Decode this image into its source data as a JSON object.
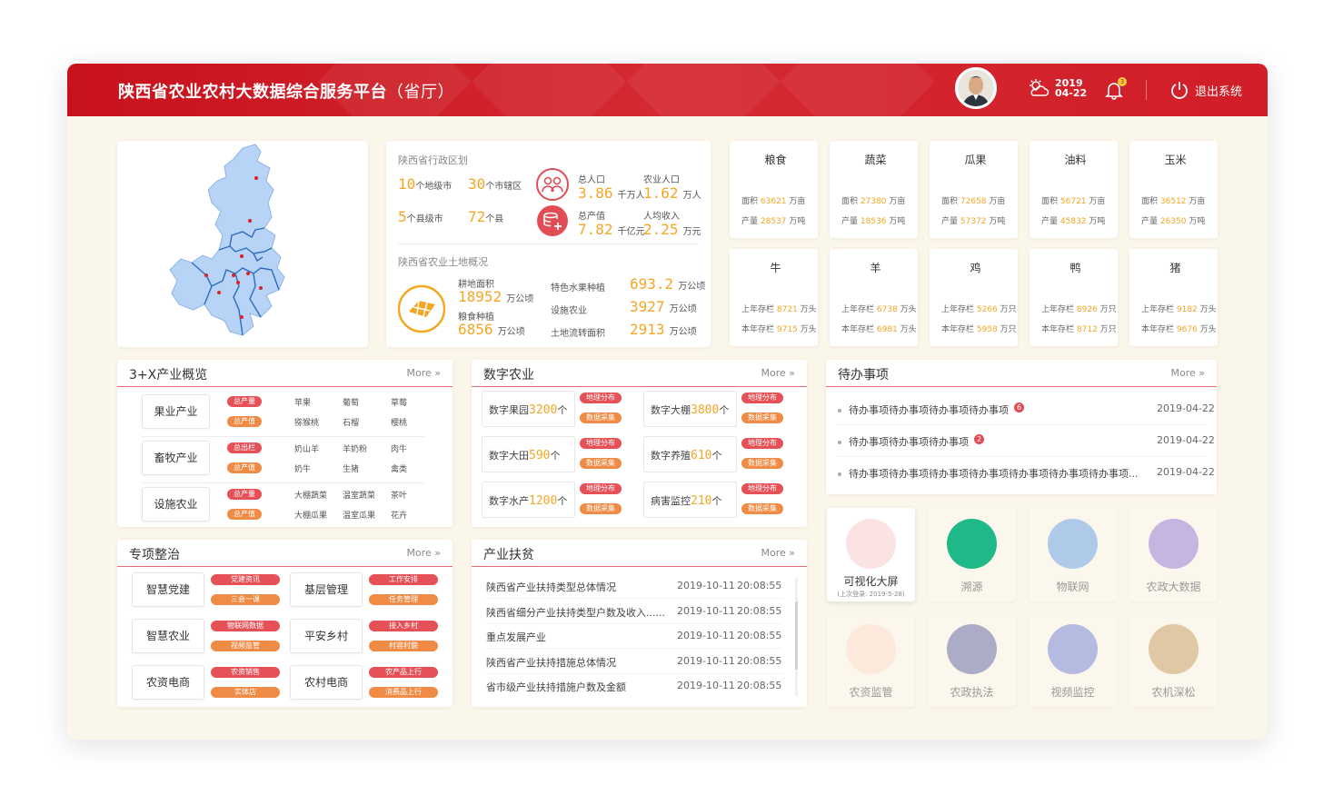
{
  "header": {
    "title": "陕西省农业农村大数据综合服务平台",
    "title_suffix": "（省厅）",
    "year": "2019",
    "date": "04-22",
    "bell_count": "3",
    "logout_label": "退出系统"
  },
  "admin": {
    "title": "陕西省行政区划",
    "prefecture_num": "10",
    "prefecture_label": "个地级市",
    "district_num": "30",
    "district_label": "个市辖区",
    "county_city_num": "5",
    "county_city_label": "个县级市",
    "county_num": "72",
    "county_label": "个县",
    "total_pop_label": "总人口",
    "total_pop_value": "3.86",
    "total_pop_unit": "千万人",
    "agri_pop_label": "农业人口",
    "agri_pop_value": "1.62",
    "agri_pop_unit": "万人",
    "output_label": "总产值",
    "output_value": "7.82",
    "output_unit": "千亿元",
    "income_label": "人均收入",
    "income_value": "2.25",
    "income_unit": "万元",
    "land_title": "陕西省农业土地概况",
    "arable_label": "耕地面积",
    "arable_value": "18952",
    "arable_unit": "万公顷",
    "grain_label": "粮食种植",
    "grain_value": "6856",
    "grain_unit": "万公顷",
    "fruit_label": "特色水果种植",
    "fruit_value": "693.2",
    "fruit_unit": "万公顷",
    "facility_label": "设施农业",
    "facility_value": "3927",
    "facility_unit": "万公顷",
    "transfer_label": "土地流转面积",
    "transfer_value": "2913",
    "transfer_unit": "万公顷"
  },
  "crops": [
    {
      "name": "粮食",
      "icon": "wheat-icon",
      "l1": "面积",
      "v1": "63621",
      "u1": "万亩",
      "l2": "产量",
      "v2": "28537",
      "u2": "万吨"
    },
    {
      "name": "蔬菜",
      "icon": "vegetable-icon",
      "l1": "面积",
      "v1": "27380",
      "u1": "万亩",
      "l2": "产量",
      "v2": "18536",
      "u2": "万吨"
    },
    {
      "name": "瓜果",
      "icon": "fruit-icon",
      "l1": "面积",
      "v1": "72658",
      "u1": "万亩",
      "l2": "产量",
      "v2": "57372",
      "u2": "万吨"
    },
    {
      "name": "油料",
      "icon": "oil-icon",
      "l1": "面积",
      "v1": "56721",
      "u1": "万亩",
      "l2": "产量",
      "v2": "45832",
      "u2": "万吨"
    },
    {
      "name": "玉米",
      "icon": "corn-icon",
      "l1": "面积",
      "v1": "36512",
      "u1": "万亩",
      "l2": "产量",
      "v2": "26350",
      "u2": "万吨"
    }
  ],
  "livestock": [
    {
      "name": "牛",
      "icon": "cow-icon",
      "l1": "上年存栏",
      "v1": "8721",
      "u1": "万头",
      "l2": "本年存栏",
      "v2": "9715",
      "u2": "万头"
    },
    {
      "name": "羊",
      "icon": "sheep-icon",
      "l1": "上年存栏",
      "v1": "6738",
      "u1": "万头",
      "l2": "本年存栏",
      "v2": "6981",
      "u2": "万头"
    },
    {
      "name": "鸡",
      "icon": "chicken-icon",
      "l1": "上年存栏",
      "v1": "5266",
      "u1": "万只",
      "l2": "本年存栏",
      "v2": "5958",
      "u2": "万只"
    },
    {
      "name": "鸭",
      "icon": "duck-icon",
      "l1": "上年存栏",
      "v1": "8926",
      "u1": "万只",
      "l2": "本年存栏",
      "v2": "8712",
      "u2": "万只"
    },
    {
      "name": "猪",
      "icon": "pig-icon",
      "l1": "上年存栏",
      "v1": "9182",
      "u1": "万头",
      "l2": "本年存栏",
      "v2": "9676",
      "u2": "万头"
    }
  ],
  "industry": {
    "title": "3+X产业概览",
    "more": "More",
    "groups": [
      {
        "name": "果业产业",
        "tag1": "总产量",
        "tag2": "总产值",
        "items": [
          "苹果",
          "葡萄",
          "草莓",
          "猕猴桃",
          "石榴",
          "樱桃"
        ]
      },
      {
        "name": "畜牧产业",
        "tag1": "总出栏",
        "tag2": "总产值",
        "items": [
          "奶山羊",
          "羊奶粉",
          "肉牛",
          "奶牛",
          "生猪",
          "禽类"
        ]
      },
      {
        "name": "设施农业",
        "tag1": "总产量",
        "tag2": "总产值",
        "items": [
          "大棚蔬菜",
          "温室蔬菜",
          "茶叶",
          "大棚瓜果",
          "温室瓜果",
          "花卉"
        ]
      }
    ]
  },
  "digital": {
    "title": "数字农业",
    "more": "More",
    "tag1": "地理分布",
    "tag2": "数据采集",
    "items": [
      {
        "label": "数字果园",
        "value": "3200",
        "unit": "个"
      },
      {
        "label": "数字大棚",
        "value": "3800",
        "unit": "个"
      },
      {
        "label": "数字大田",
        "value": "590",
        "unit": "个"
      },
      {
        "label": "数字养殖",
        "value": "610",
        "unit": "个"
      },
      {
        "label": "数字水产",
        "value": "1200",
        "unit": "个"
      },
      {
        "label": "病害监控",
        "value": "210",
        "unit": "个"
      }
    ]
  },
  "todo": {
    "title": "待办事项",
    "more": "More",
    "items": [
      {
        "text": "待办事项待办事项待办事项待办事项",
        "badge": "6",
        "date": "2019-04-22"
      },
      {
        "text": "待办事项待办事项待办事项",
        "badge": "2",
        "date": "2019-04-22"
      },
      {
        "text": "待办事项待办事项待办事项待办事项待办事项待办事项待办事项...",
        "badge": "",
        "date": "2019-04-22"
      }
    ]
  },
  "special": {
    "title": "专项整治",
    "more": "More",
    "items": [
      {
        "name": "智慧党建",
        "tag1": "党建资讯",
        "tag2": "三会一课"
      },
      {
        "name": "基层管理",
        "tag1": "工作安排",
        "tag2": "任务管理"
      },
      {
        "name": "智慧农业",
        "tag1": "物联网数据",
        "tag2": "视频监管"
      },
      {
        "name": "平安乡村",
        "tag1": "接入乡村",
        "tag2": "村容村貌"
      },
      {
        "name": "农资电商",
        "tag1": "农资销售",
        "tag2": "实体店"
      },
      {
        "name": "农村电商",
        "tag1": "农产品上行",
        "tag2": "消费品上行"
      }
    ]
  },
  "poverty": {
    "title": "产业扶贫",
    "more": "More",
    "items": [
      {
        "text": "陕西省产业扶持类型总体情况",
        "date": "2019-10-11",
        "time": "20:08:55"
      },
      {
        "text": "陕西省细分产业扶持类型户数及收入......",
        "date": "2019-10-11",
        "time": "20:08:55"
      },
      {
        "text": "重点发展产业",
        "date": "2019-10-11",
        "time": "20:08:55"
      },
      {
        "text": "陕西省产业扶持措施总体情况",
        "date": "2019-10-11",
        "time": "20:08:55"
      },
      {
        "text": "省市级产业扶持措施户数及金额",
        "date": "2019-10-11",
        "time": "20:08:55"
      }
    ]
  },
  "apps": [
    {
      "label": "可视化大屏",
      "sub": "(上次登录: 2019-5-28)",
      "icon": "screen-eye-icon",
      "color": "#e0484f"
    },
    {
      "label": "溯源",
      "sub": "",
      "icon": "trace-icon",
      "color": "#1fb889"
    },
    {
      "label": "物联网",
      "sub": "",
      "icon": "iot-icon",
      "color": "#6fa6e8"
    },
    {
      "label": "农政大数据",
      "sub": "",
      "icon": "bigdata-icon",
      "color": "#9b7fd9"
    },
    {
      "label": "农资监管",
      "sub": "",
      "icon": "supervise-icon",
      "color": "#f08a4b"
    },
    {
      "label": "农政执法",
      "sub": "",
      "icon": "police-icon",
      "color": "#6a6fa8"
    },
    {
      "label": "视频监控",
      "sub": "",
      "icon": "camera-icon",
      "color": "#7a88d8"
    },
    {
      "label": "农机深松",
      "sub": "",
      "icon": "tractor-icon",
      "color": "#c9a36a"
    }
  ]
}
